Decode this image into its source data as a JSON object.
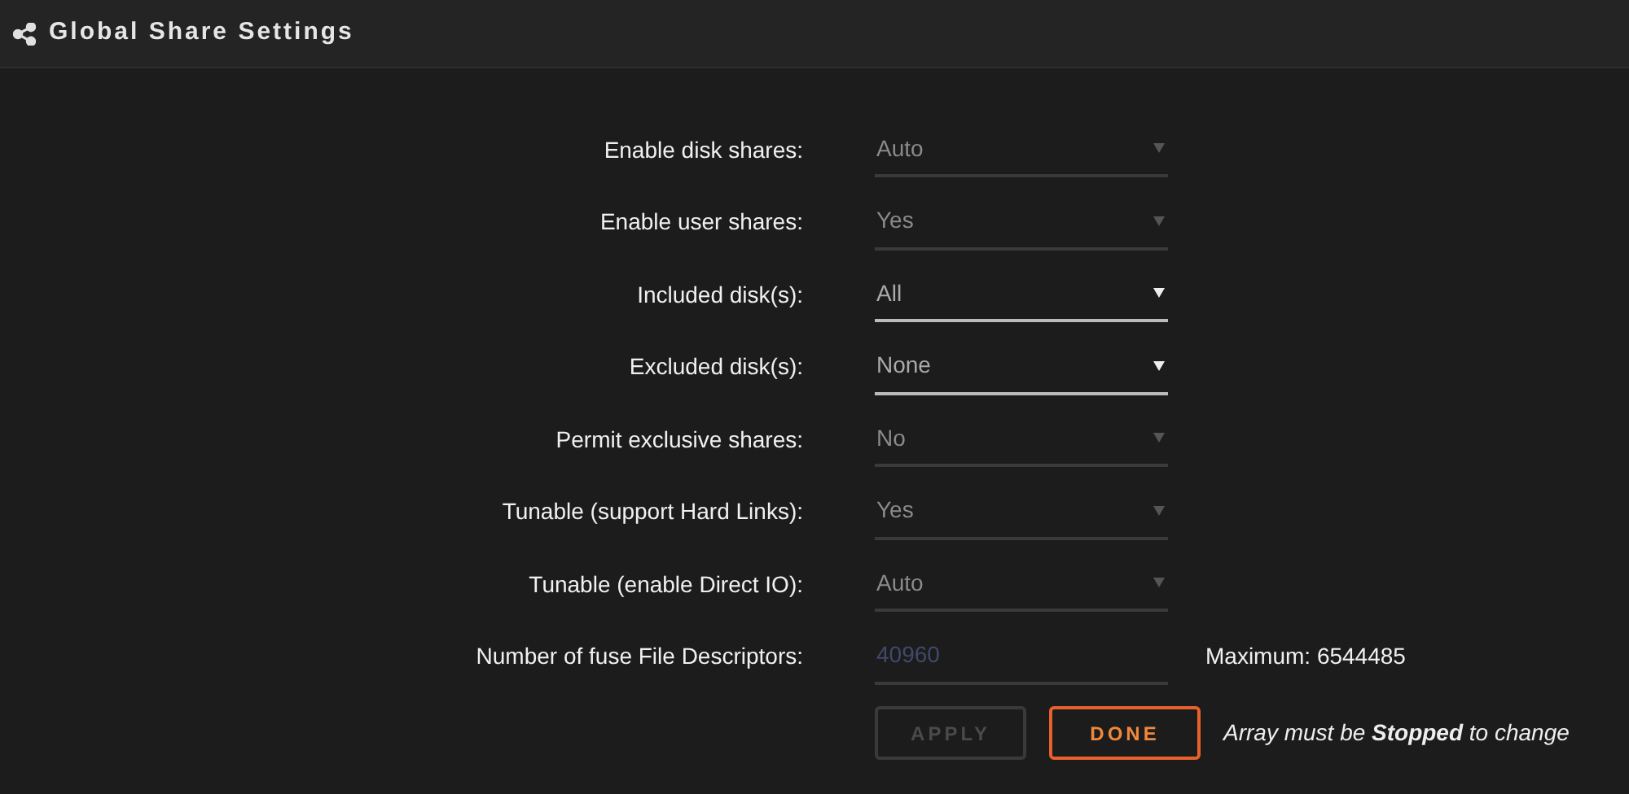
{
  "header": {
    "title": "Global Share Settings"
  },
  "settings": [
    {
      "kind": "select",
      "label": "Enable disk shares:",
      "value": "Auto",
      "disabled": true
    },
    {
      "kind": "select",
      "label": "Enable user shares:",
      "value": "Yes",
      "disabled": true
    },
    {
      "kind": "select",
      "label": "Included disk(s):",
      "value": "All",
      "disabled": false
    },
    {
      "kind": "select",
      "label": "Excluded disk(s):",
      "value": "None",
      "disabled": false
    },
    {
      "kind": "select",
      "label": "Permit exclusive shares:",
      "value": "No",
      "disabled": true
    },
    {
      "kind": "select",
      "label": "Tunable (support Hard Links):",
      "value": "Yes",
      "disabled": true
    },
    {
      "kind": "select",
      "label": "Tunable (enable Direct IO):",
      "value": "Auto",
      "disabled": true
    },
    {
      "kind": "number",
      "label": "Number of fuse File Descriptors:",
      "value": "40960",
      "disabled": true,
      "note": "Maximum: 6544485"
    }
  ],
  "buttons": [
    {
      "label": "APPLY",
      "disabled": true
    },
    {
      "label": "DONE",
      "disabled": false
    }
  ],
  "message": "Array must be **Stopped** to change"
}
